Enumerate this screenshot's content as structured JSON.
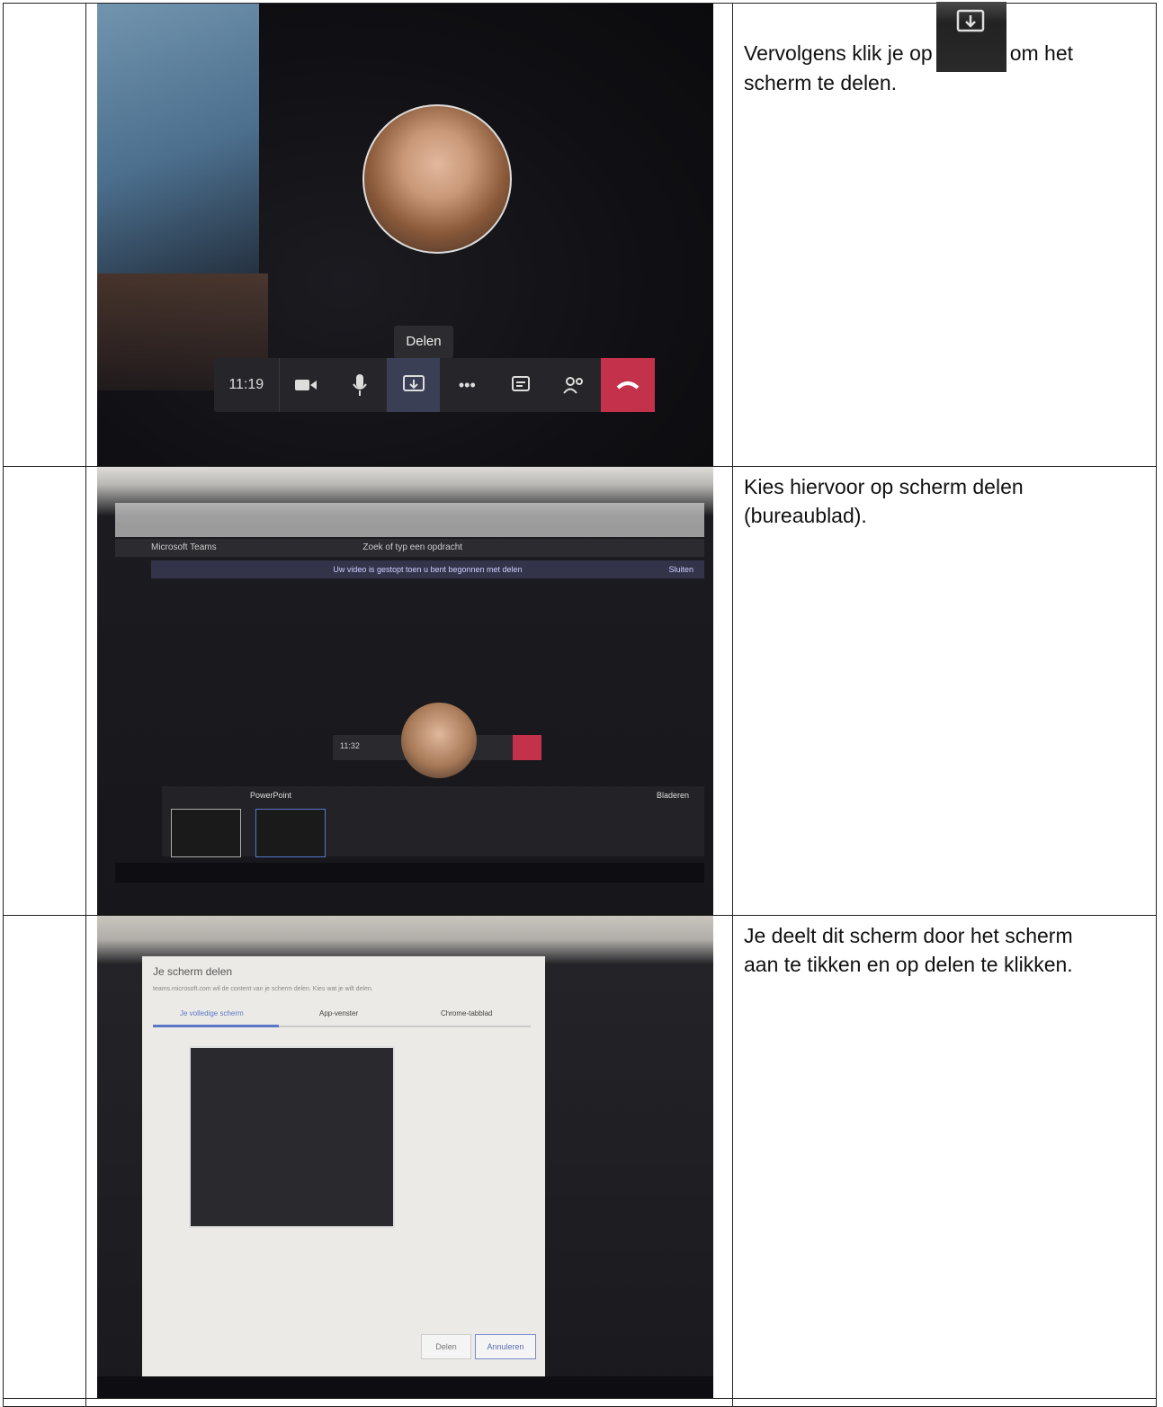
{
  "rows": [
    {
      "caption_before_icon": "Vervolgens klik je op",
      "caption_after_icon": "om het",
      "caption_line2": "scherm te delen.",
      "inline_icon": "share-screen-icon",
      "screenshot": {
        "tooltip": "Delen",
        "call_time": "11:19",
        "icons": [
          "camera-icon",
          "microphone-icon",
          "share-screen-icon",
          "more-icon",
          "chat-icon",
          "participants-icon",
          "hang-up-icon"
        ],
        "colors": {
          "hang_up": "#c4314b",
          "bar": "#26262a"
        }
      }
    },
    {
      "caption_line1": "Kies hiervoor op scherm delen",
      "caption_line2": "(bureaublad).",
      "screenshot": {
        "app_name": "Microsoft Teams",
        "search_placeholder": "Zoek of typ een opdracht",
        "notice": "Uw video is gestopt toen u bent begonnen met delen",
        "close_label": "Sluiten",
        "call_time": "11:32",
        "section_label": "PowerPoint",
        "browse_label": "Bladeren"
      }
    },
    {
      "caption_line1": "Je deelt dit scherm door het scherm",
      "caption_line2": "aan te tikken en op delen te klikken.",
      "screenshot": {
        "dialog_title": "Je scherm delen",
        "dialog_subtitle": "teams.microsoft.com wil de content van je scherm delen. Kies wat je wilt delen.",
        "tabs": [
          "Je volledige scherm",
          "App-venster",
          "Chrome-tabblad"
        ],
        "share_button": "Delen",
        "cancel_button": "Annuleren"
      }
    },
    {}
  ]
}
